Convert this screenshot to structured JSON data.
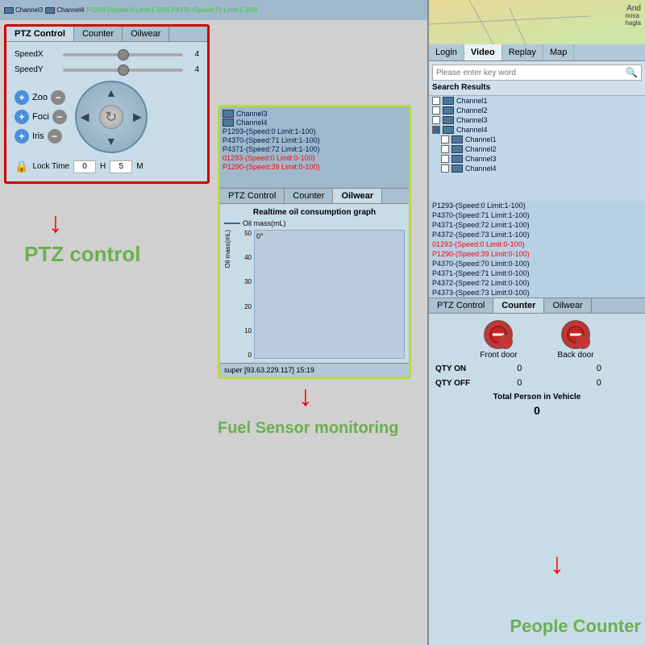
{
  "ptz": {
    "tabs": [
      "PTZ Control",
      "Counter",
      "Oilwear"
    ],
    "active_tab": "PTZ Control",
    "speedx_label": "SpeedX",
    "speedy_label": "SpeedY",
    "speedx_val": "4",
    "speedy_val": "4",
    "zoom_label": "Zoo",
    "focus_label": "Foci",
    "iris_label": "Iris",
    "lock_label": "Lock Time",
    "lock_h": "0",
    "lock_m": "5",
    "lock_h_unit": "H",
    "lock_m_unit": "M"
  },
  "ptz_label": "PTZ control",
  "fuel_label": "Fuel Sensor monitoring",
  "people_label": "People Counter",
  "fuel": {
    "tabs": [
      "PTZ Control",
      "Counter",
      "Oilwear"
    ],
    "active_tab": "Oilwear",
    "graph_title": "Realtime oil consumption graph",
    "legend_label": "Oil mass(mL)",
    "y_axis_label": "Oil mass(mL)",
    "degree": "0°",
    "footer": "super [93.63.229.117] 15:19",
    "channels": [
      "Channel3",
      "Channel4"
    ],
    "channel_texts": [
      "P1293-(Speed:0 Limit:1-100)",
      "P4370-(Speed:71 Limit:1-100)",
      "P4371-(Speed:72 Limit:1-100)",
      "P4372-(Speed:73 Limit:1-100)",
      "01293-(Speed:0 Limit:0-100)",
      "P1290-(Speed:39 Limit:0-100)",
      "P4370-(Speed:70 Limit:0-100)",
      "P4371-(Speed:71 Limit:0-100)",
      "P4372-(Speed:72 Limit:0-100)"
    ],
    "y_values": [
      "50",
      "40",
      "30",
      "20",
      "10",
      "0"
    ]
  },
  "right": {
    "nav_tabs": [
      "Login",
      "Video",
      "Replay",
      "Map"
    ],
    "active_tab": "Video",
    "search_placeholder": "Please enter key word",
    "search_results_label": "Search Results",
    "channels_top": [
      {
        "name": "Channel1",
        "checked": false
      },
      {
        "name": "Channel2",
        "checked": false
      },
      {
        "name": "Channel3",
        "checked": false
      },
      {
        "name": "Channel4",
        "checked": true
      }
    ],
    "channels_bottom": [
      {
        "name": "Channel1",
        "checked": false
      },
      {
        "name": "Channel2",
        "checked": false
      },
      {
        "name": "Channel3",
        "checked": false
      },
      {
        "name": "Channel4",
        "checked": false
      }
    ],
    "channel_texts": [
      "P1293-(Speed:0 Limit:1-100)",
      "P4370-(Speed:71 Limit:1-100)",
      "P4371-(Speed:72 Limit:1-100)",
      "P4372-(Speed:73 Limit:1-100)",
      "01293-(Speed:0 Limit:0-100)",
      "P1290-(Speed:39 Limit:0-100)",
      "P4370-(Speed:70 Limit:0-100)",
      "P4371-(Speed:71 Limit:0-100)",
      "P4372-(Speed:72 Limit:0-100)",
      "P4373-(Speed:73 Limit:0-100)"
    ],
    "bottom_tabs": [
      "PTZ Control",
      "Counter",
      "Oilwear"
    ],
    "bottom_active": "Counter",
    "front_door_label": "Front door",
    "back_door_label": "Back door",
    "qty_on_label": "QTY ON",
    "qty_off_label": "QTY OFF",
    "total_label": "Total Person in Vehicle",
    "front_qty_on": "0",
    "back_qty_on": "0",
    "front_qty_off": "0",
    "back_qty_off": "0",
    "total_val": "0",
    "map_text": "And",
    "map_subtext": "nosa\nhagla"
  },
  "top_channels": [
    "Channel3",
    "Channel4"
  ],
  "icons": {
    "search": "🔍",
    "lock": "🔒",
    "rotate": "↻",
    "up": "▲",
    "down": "▼",
    "left": "◀",
    "right": "▶",
    "plus": "+",
    "minus": "−",
    "person": "👤",
    "no_entry": "🚫"
  }
}
